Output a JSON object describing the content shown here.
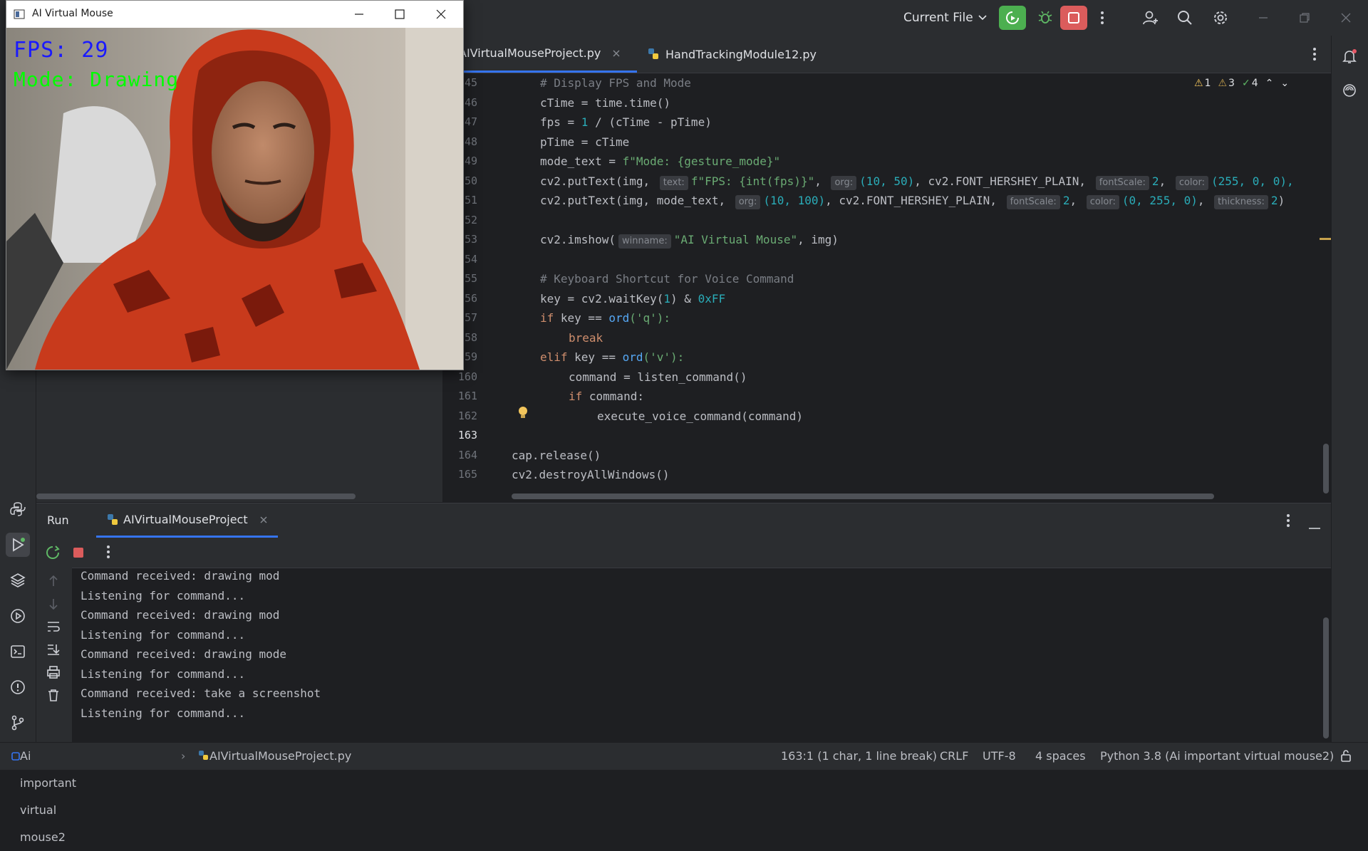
{
  "toolbar": {
    "run_config": "Current File",
    "run_config_chevron": "chevron-down-icon"
  },
  "editor": {
    "tabs": [
      {
        "label": "AIVirtualMouseProject.py",
        "active": true
      },
      {
        "label": "HandTrackingModule12.py",
        "active": false
      }
    ],
    "inspections": {
      "warnings_a": "1",
      "warnings_b": "3",
      "ok": "4"
    },
    "current_line": 163,
    "lines": [
      {
        "num": "45"
      },
      {
        "num": "46"
      },
      {
        "num": "47"
      },
      {
        "num": "48"
      },
      {
        "num": "49"
      },
      {
        "num": "50"
      },
      {
        "num": "51"
      },
      {
        "num": "52"
      },
      {
        "num": "53"
      },
      {
        "num": "54"
      },
      {
        "num": "55"
      },
      {
        "num": "56"
      },
      {
        "num": "57"
      },
      {
        "num": "58"
      },
      {
        "num": "59"
      },
      {
        "num": "160"
      },
      {
        "num": "161"
      },
      {
        "num": "162"
      },
      {
        "num": "163"
      },
      {
        "num": "164"
      },
      {
        "num": "165"
      }
    ],
    "code": {
      "l45": "# Display FPS and Mode",
      "l46": "cTime = time.time()",
      "l47a": "fps = ",
      "l47b": "1",
      "l47c": " / (cTime - pTime)",
      "l48": "pTime = cTime",
      "l49a": "mode_text = ",
      "l49b": "f\"Mode: {gesture_mode}\"",
      "l50a": "cv2.putText(img, ",
      "l50h1": "text:",
      "l50b": "f\"FPS: {int(fps)}\"",
      "l50c": ", ",
      "l50h2": "org:",
      "l50d": "(10, 50)",
      "l50e": ", cv2.FONT_HERSHEY_PLAIN, ",
      "l50h3": "fontScale:",
      "l50f": "2",
      "l50g": ", ",
      "l50h4": "color:",
      "l50i": "(255, 0, 0),",
      "l51a": "cv2.putText(img, mode_text, ",
      "l51h1": "org:",
      "l51b": "(10, 100)",
      "l51c": ", cv2.FONT_HERSHEY_PLAIN, ",
      "l51h2": "fontScale:",
      "l51d": "2",
      "l51e": ", ",
      "l51h3": "color:",
      "l51f": "(0, 255, 0)",
      "l51g": ", ",
      "l51h4": "thickness:",
      "l51i": "2",
      "l51j": ")",
      "l53a": "cv2.imshow(",
      "l53h": "winname:",
      "l53b": "\"AI Virtual Mouse\"",
      "l53c": ", img)",
      "l55": "# Keyboard Shortcut for Voice Command",
      "l56a": "key = cv2.waitKey(",
      "l56b": "1",
      "l56c": ") & ",
      "l56d": "0xFF",
      "l57a": "if",
      "l57b": " key == ",
      "l57c": "ord",
      "l57d": "('q'):",
      "l58": "break",
      "l59a": "elif",
      "l59b": " key == ",
      "l59c": "ord",
      "l59d": "('v'):",
      "l160": "command = listen_command()",
      "l161a": "if",
      "l161b": " command:",
      "l162": "execute_voice_command(command)",
      "l164": "cap.release()",
      "l165": "cv2.destroyAllWindows()"
    }
  },
  "run": {
    "title": "Run",
    "tab": "AIVirtualMouseProject",
    "output": [
      "Command received: drawing mod",
      "Listening for command...",
      "Command received: drawing mod",
      "Listening for command...",
      "Command received: drawing mode",
      "Listening for command...",
      "Command received: take a screenshot",
      "Listening for command..."
    ]
  },
  "status": {
    "project": "Ai important virtual mouse2",
    "file": "AIVirtualMouseProject.py",
    "position": "163:1 (1 char, 1 line break)",
    "line_sep": "CRLF",
    "encoding": "UTF-8",
    "indent": "4 spaces",
    "interpreter": "Python 3.8 (Ai important virtual mouse2)"
  },
  "camera_window": {
    "title": "AI Virtual Mouse",
    "fps_text": "FPS: 29",
    "mode_text": "Mode: Drawing",
    "fps_color": "#1a1aff",
    "mode_color": "#00ff00"
  },
  "colors": {
    "accent": "#3574f0",
    "run": "#4caf50",
    "stop": "#db5c5c",
    "selection": "#214283"
  }
}
